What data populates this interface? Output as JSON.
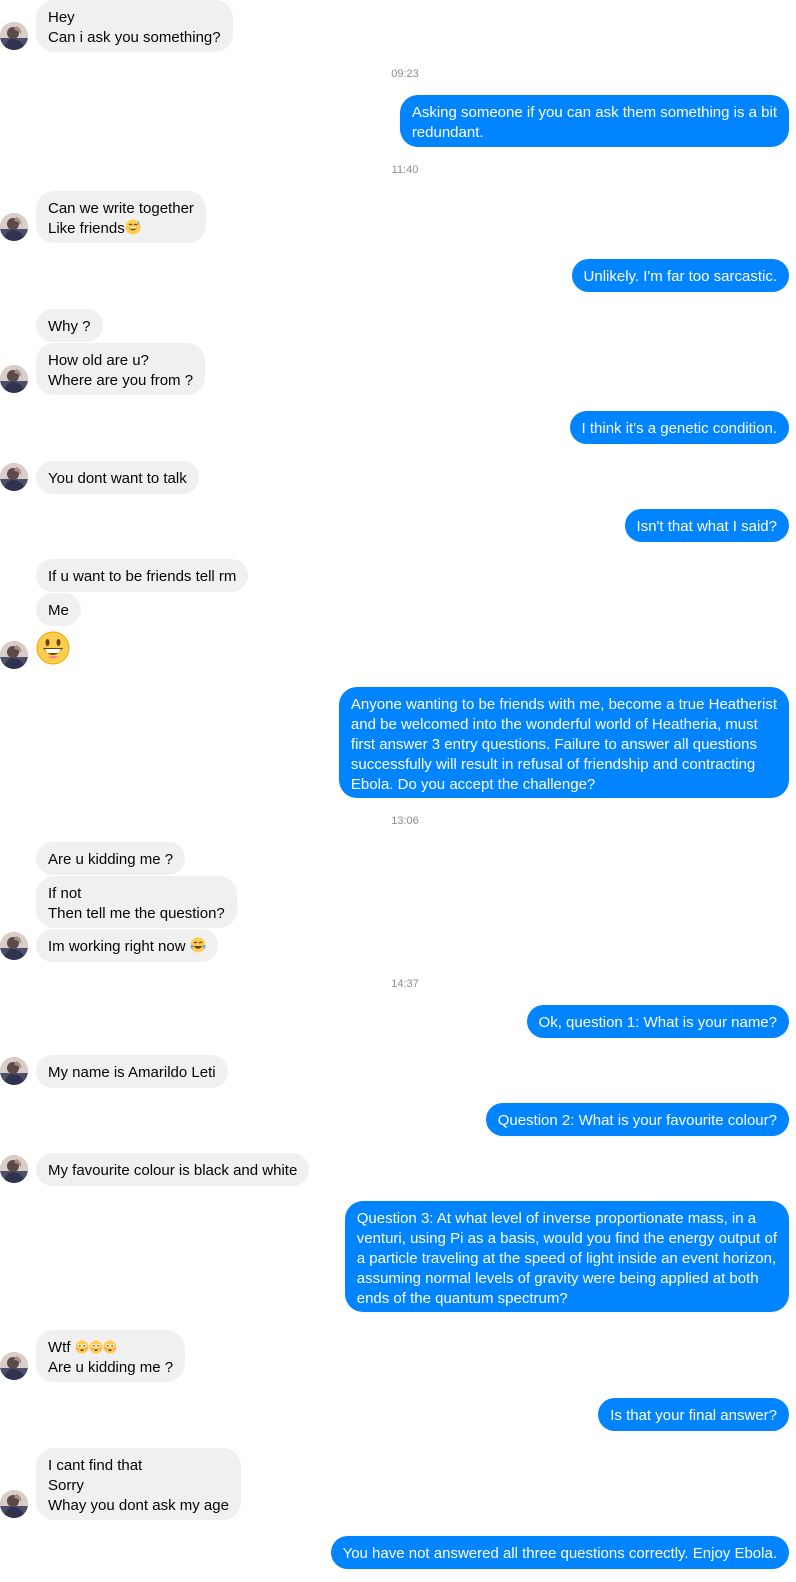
{
  "timestamps": [
    "09:23",
    "11:40",
    "13:06",
    "14:37"
  ],
  "messages": [
    {
      "from": "them",
      "text": "Hey\nCan i ask you something?"
    },
    {
      "from": "me",
      "text": "Asking someone if you can ask them something is a bit\nredundant."
    },
    {
      "from": "them",
      "text": "Can we write together\nLike friends",
      "trailing_emoji": "grinning-sweat-emoji"
    },
    {
      "from": "me",
      "text": "Unlikely. I'm far too sarcastic."
    },
    {
      "from": "them",
      "text": "Why ?"
    },
    {
      "from": "them",
      "text": "How old are u?\nWhere are you from ?"
    },
    {
      "from": "me",
      "text": "I think it's a genetic condition."
    },
    {
      "from": "them",
      "text": "You dont want to talk"
    },
    {
      "from": "me",
      "text": "Isn't that what I said?"
    },
    {
      "from": "them",
      "text": "If u want to be friends tell rm"
    },
    {
      "from": "them",
      "text": "Me"
    },
    {
      "from": "them",
      "emoji": "grinning-face-emoji"
    },
    {
      "from": "me",
      "text": "Anyone wanting to be friends with me, become a true Heatherist\nand be welcomed into the wonderful world of Heatheria, must\nfirst answer 3 entry questions. Failure to answer all questions\nsuccessfully will result in refusal of friendship and contracting\nEbola. Do you accept the challenge?"
    },
    {
      "from": "them",
      "text": "Are u kidding me ?"
    },
    {
      "from": "them",
      "text": "If not\nThen tell me the question?"
    },
    {
      "from": "them",
      "text": "Im working right now ",
      "trailing_emoji": "tears-of-joy-emoji"
    },
    {
      "from": "me",
      "text": "Ok, question 1: What is your name?"
    },
    {
      "from": "them",
      "text": "My name is Amarildo Leti"
    },
    {
      "from": "me",
      "text": "Question 2: What is your favourite colour?"
    },
    {
      "from": "them",
      "text": "My favourite colour is black and white"
    },
    {
      "from": "me",
      "text": "Question 3: At what level of inverse proportionate mass, in a\nventuri, using Pi as a basis, would you find the energy output of\na particle traveling at the speed of light inside an event horizon,\nassuming normal levels of gravity were being applied at both\nends of the quantum spectrum?"
    },
    {
      "from": "them",
      "text": "Wtf ",
      "trailing_emoji": "flushed-emoji-x3",
      "text_after": "\nAre u kidding me ?"
    },
    {
      "from": "me",
      "text": "Is that your final answer?"
    },
    {
      "from": "them",
      "text": "I cant find that\nSorry\nWhay you dont ask my age"
    },
    {
      "from": "me",
      "text": "You have not answered all three questions correctly. Enjoy Ebola."
    }
  ],
  "colors": {
    "outgoing_bubble": "#0084ff",
    "incoming_bubble": "#f0f0f0",
    "timestamp_text": "#8a8d91"
  }
}
